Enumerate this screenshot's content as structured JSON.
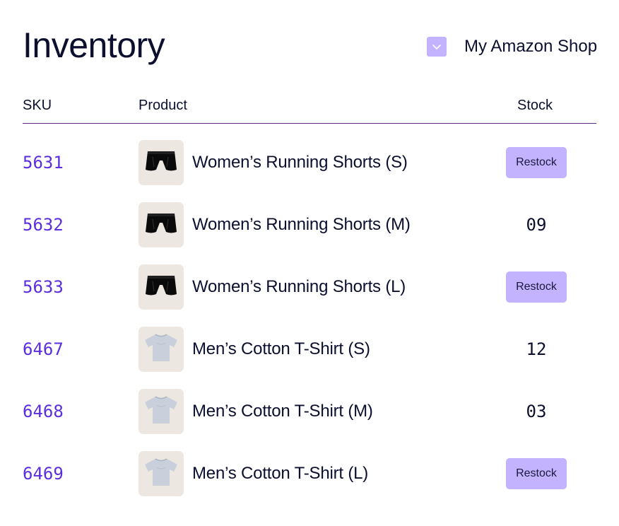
{
  "page_title": "Inventory",
  "shop_selector": {
    "label": "My Amazon Shop",
    "icon": "chevron-down-icon"
  },
  "table": {
    "headers": {
      "sku": "SKU",
      "product": "Product",
      "stock": "Stock"
    },
    "rows": [
      {
        "sku": "5631",
        "product": "Women’s Running Shorts (S)",
        "stock": "Restock",
        "image": "running-shorts-icon"
      },
      {
        "sku": "5632",
        "product": "Women’s Running Shorts (M)",
        "stock": "09",
        "image": "running-shorts-icon"
      },
      {
        "sku": "5633",
        "product": "Women’s Running Shorts (L)",
        "stock": "Restock",
        "image": "running-shorts-icon"
      },
      {
        "sku": "6467",
        "product": "Men’s Cotton T-Shirt (S)",
        "stock": "12",
        "image": "tshirt-icon"
      },
      {
        "sku": "6468",
        "product": "Men’s Cotton T-Shirt (M)",
        "stock": "03",
        "image": "tshirt-icon"
      },
      {
        "sku": "6469",
        "product": "Men’s Cotton T-Shirt (L)",
        "stock": "Restock",
        "image": "tshirt-icon"
      }
    ]
  },
  "colors": {
    "accent": "#c3b3ff",
    "sku_link": "#5b2de0",
    "text": "#0c0f2e",
    "divider": "#5c2a7a",
    "thumb_bg": "#ece7e1"
  }
}
